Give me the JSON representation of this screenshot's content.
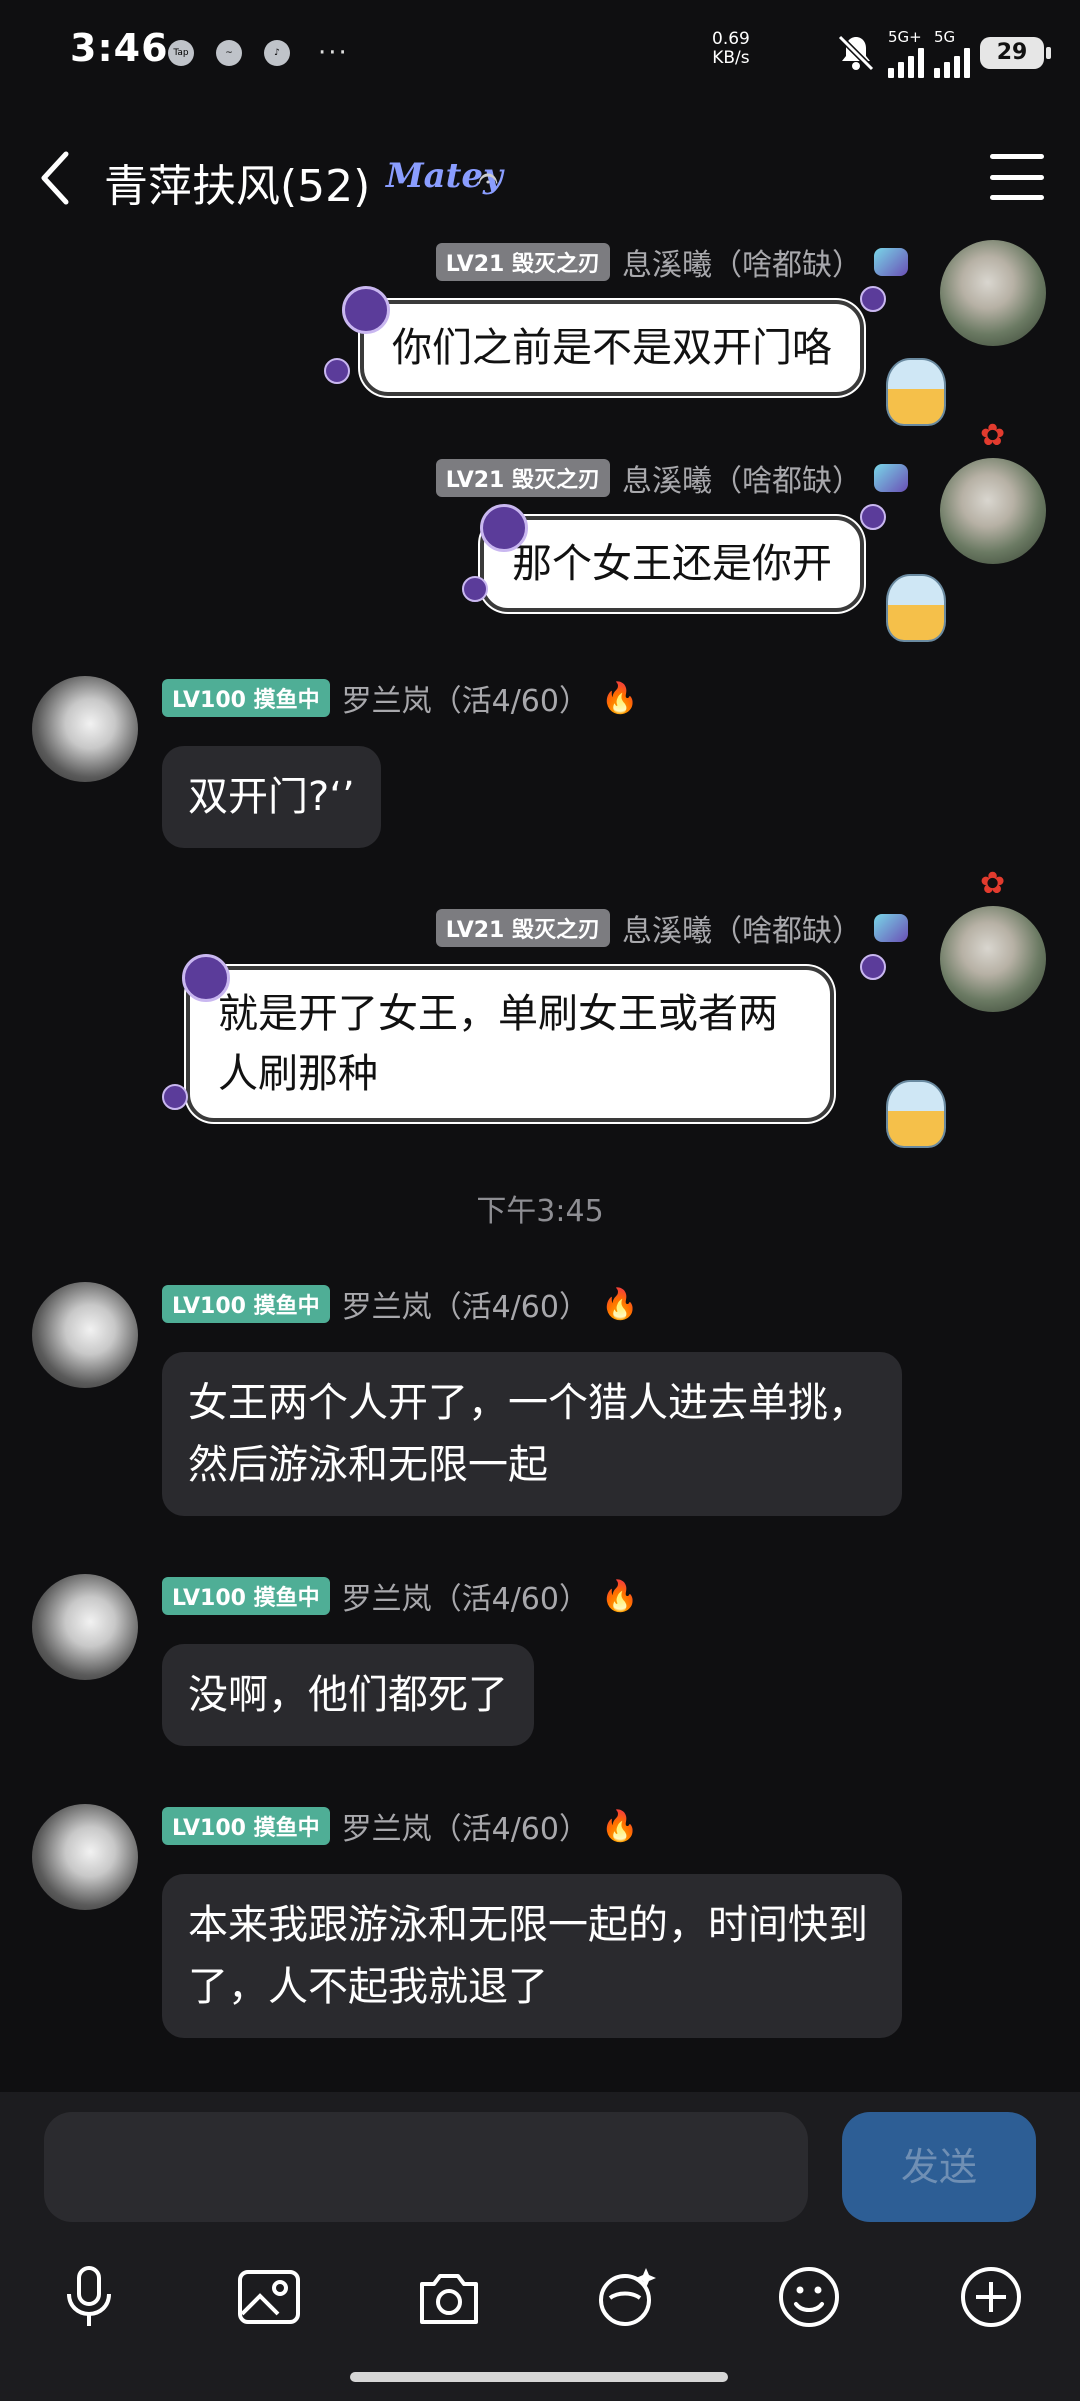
{
  "status": {
    "time": "3:46",
    "net_speed": "0.69",
    "net_unit": "KB/s",
    "sim1": "5G+",
    "sim2": "5G",
    "battery": "29",
    "more": "···"
  },
  "header": {
    "title": "青萍扶风(52)",
    "logo_text": "Matey"
  },
  "messages": [
    {
      "side": "me",
      "badge": "LV21 毁灭之刃",
      "name": "息溪曦（啥都缺）",
      "text": "你们之前是不是双开门咯"
    },
    {
      "side": "me",
      "badge": "LV21 毁灭之刃",
      "name": "息溪曦（啥都缺）",
      "text": "那个女王还是你开"
    },
    {
      "side": "them",
      "badge": "LV100 摸鱼中",
      "name": "罗兰岚（活4/60）",
      "text": "双开门?‘’"
    },
    {
      "side": "me",
      "badge": "LV21 毁灭之刃",
      "name": "息溪曦（啥都缺）",
      "text": "就是开了女王，单刷女王或者两人刷那种"
    },
    {
      "side": "them",
      "badge": "LV100 摸鱼中",
      "name": "罗兰岚（活4/60）",
      "text": "女王两个人开了，一个猎人进去单挑，然后游泳和无限一起"
    },
    {
      "side": "them",
      "badge": "LV100 摸鱼中",
      "name": "罗兰岚（活4/60）",
      "text": "没啊，他们都死了"
    },
    {
      "side": "them",
      "badge": "LV100 摸鱼中",
      "name": "罗兰岚（活4/60）",
      "text": "本来我跟游泳和无限一起的，时间快到了，人不起我就退了"
    }
  ],
  "timestamp": "下午3:45",
  "composer": {
    "placeholder": "",
    "send_label": "发送"
  },
  "toolbar": [
    "microphone-icon",
    "image-icon",
    "camera-icon",
    "sticker-icon",
    "emoji-icon",
    "plus-icon"
  ]
}
